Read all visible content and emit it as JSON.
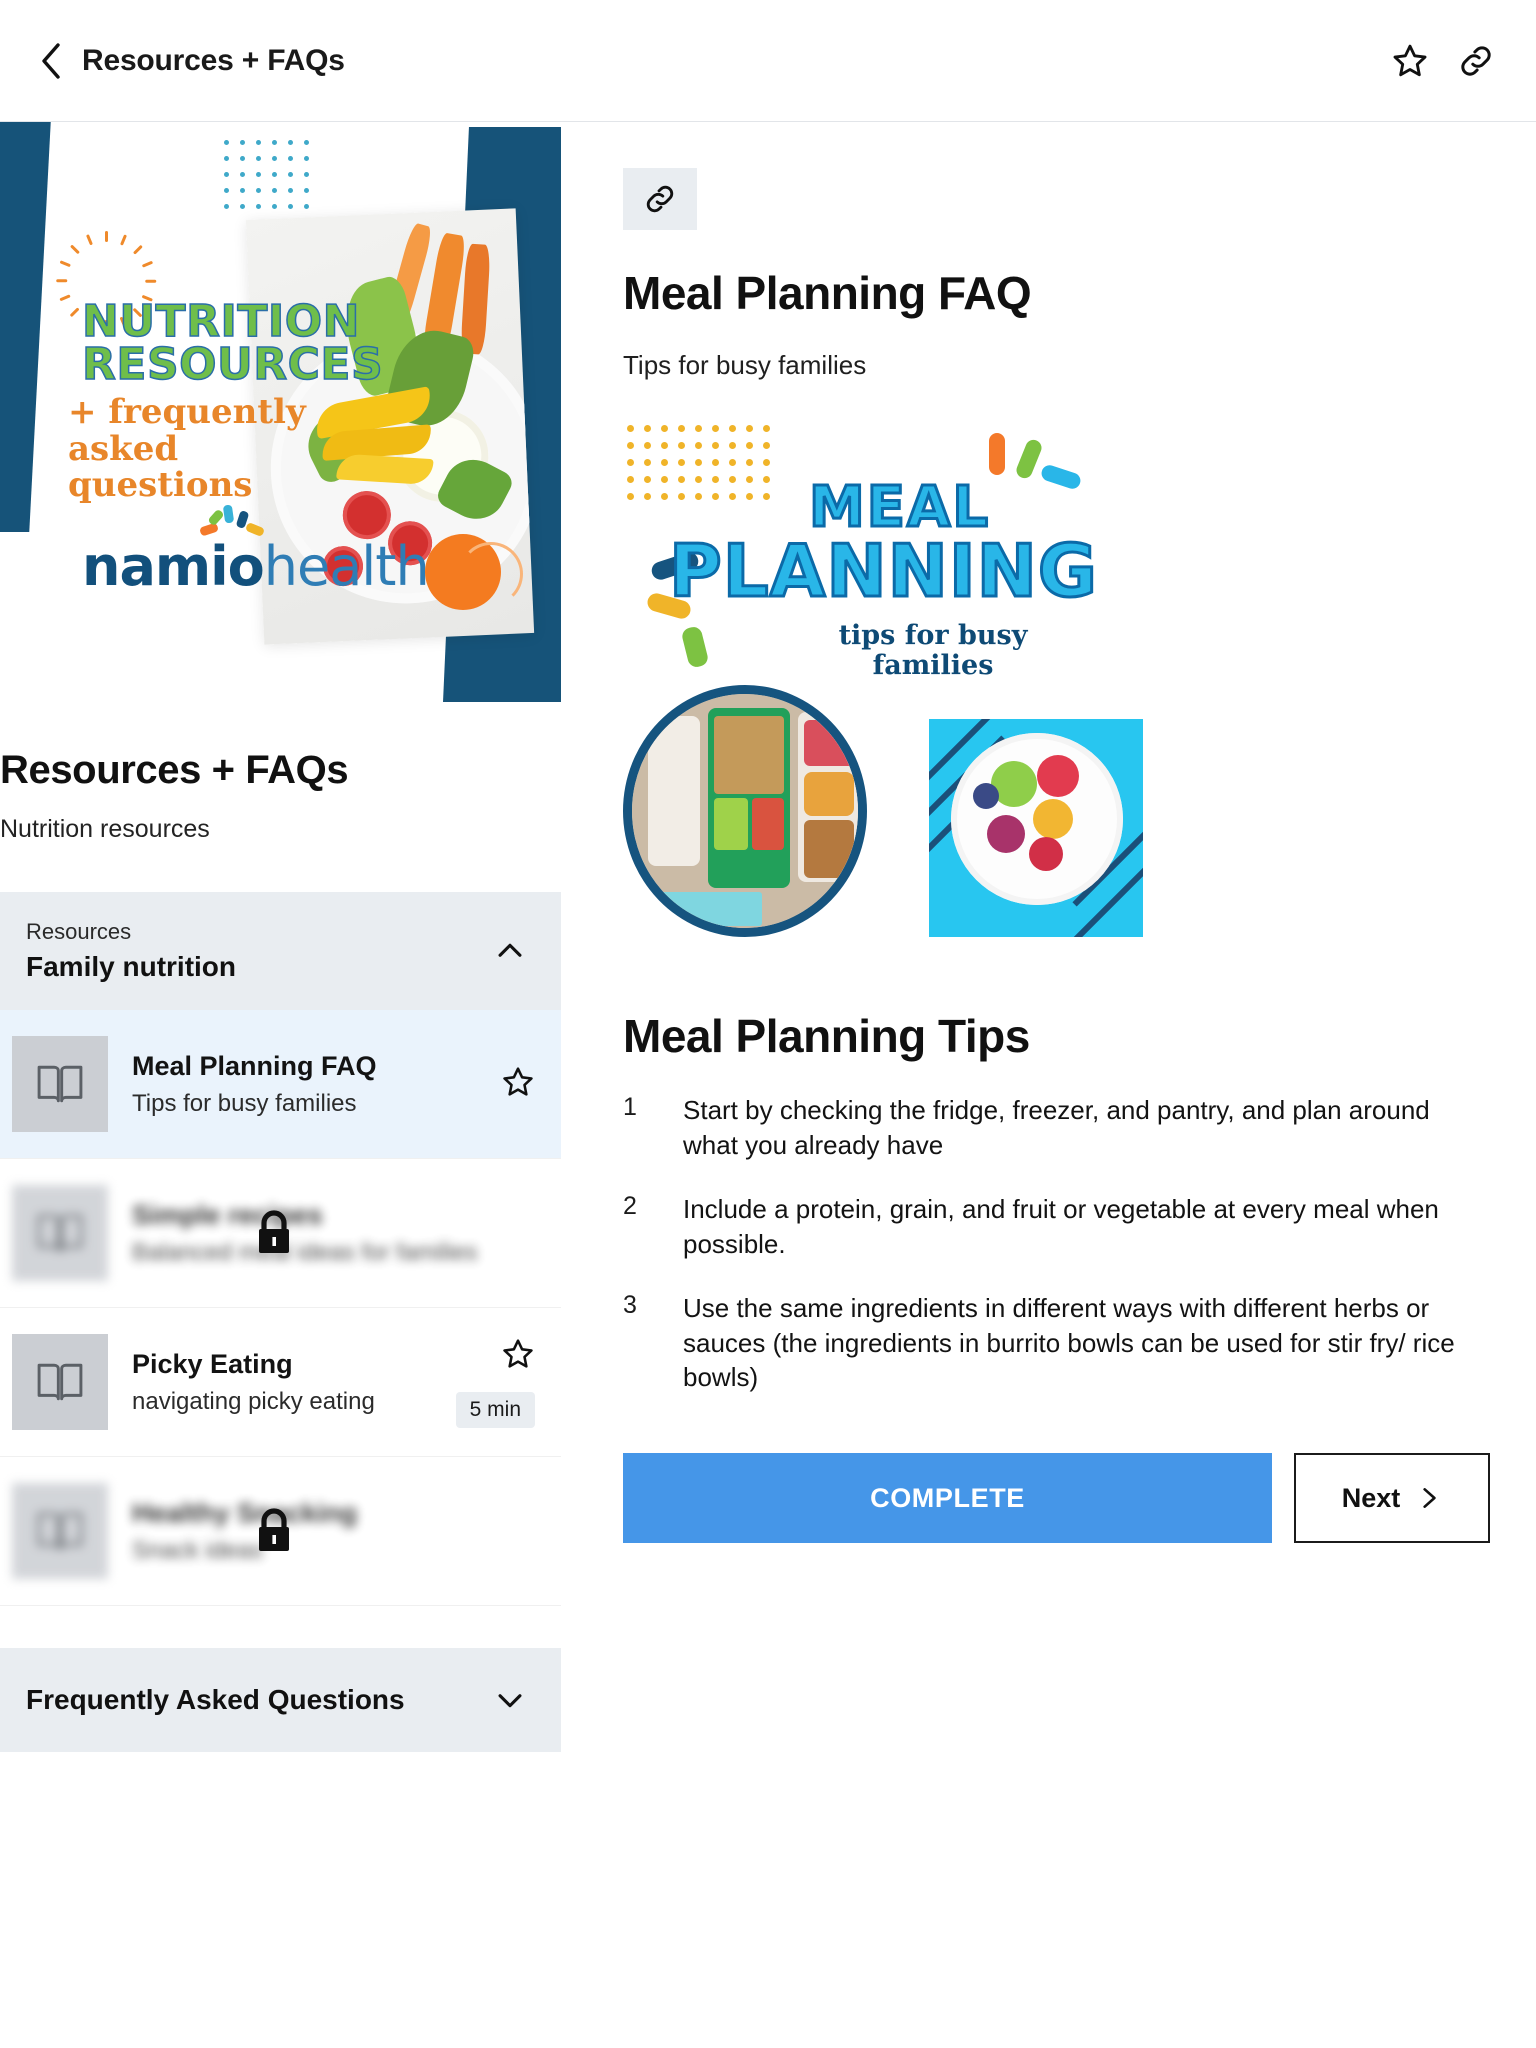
{
  "topbar": {
    "back_icon": "chevron-left-icon",
    "title": "Resources + FAQs",
    "star_icon": "star-outline-icon",
    "link_icon": "link-icon"
  },
  "hero": {
    "title_line1": "NUTRITION",
    "title_line2": "RESOURCES",
    "sub_line1": "+ frequently",
    "sub_line2": "asked",
    "sub_line3": "questions",
    "logo_primary": "namio",
    "logo_secondary": "health",
    "colors": {
      "navy": "#165379",
      "green": "#6fbe4a",
      "orange": "#e8862a",
      "dots": "#3fa9c9"
    }
  },
  "left": {
    "title": "Resources + FAQs",
    "subtitle": "Nutrition resources",
    "accordion": {
      "kicker": "Resources",
      "title": "Family nutrition",
      "expanded": true,
      "chevron_icon": "chevron-up-icon"
    },
    "items": [
      {
        "title": "Meal Planning FAQ",
        "subtitle": "Tips for busy families",
        "icon": "book-open-icon",
        "active": true,
        "locked": false,
        "star_icon": "star-outline-icon",
        "duration": ""
      },
      {
        "title": "Simple recipes",
        "subtitle": "Balanced meal ideas for families",
        "icon": "book-open-icon",
        "active": false,
        "locked": true,
        "lock_icon": "lock-icon",
        "star_icon": "",
        "duration": ""
      },
      {
        "title": "Picky Eating",
        "subtitle": "navigating picky eating",
        "icon": "book-open-icon",
        "active": false,
        "locked": false,
        "star_icon": "star-outline-icon",
        "duration": "5 min"
      },
      {
        "title": "Healthy Snacking",
        "subtitle": "Snack ideas",
        "icon": "book-open-icon",
        "active": false,
        "locked": true,
        "lock_icon": "lock-icon",
        "star_icon": "",
        "duration": ""
      }
    ],
    "faq_section": {
      "title": "Frequently Asked Questions",
      "chevron_icon": "chevron-down-icon",
      "expanded": false
    }
  },
  "right": {
    "link_icon": "link-icon",
    "title": "Meal Planning FAQ",
    "subtitle": "Tips for busy families",
    "banner": {
      "word1": "MEAL",
      "word2": "PLANNING",
      "tagline_line1": "tips for busy",
      "tagline_line2": "families",
      "colors": {
        "cyan": "#29b6e8",
        "deep_blue": "#0b6aa8",
        "gold": "#f0b429"
      }
    },
    "tips_title": "Meal Planning Tips",
    "tips": [
      {
        "num": "1",
        "text": "Start by checking the fridge, freezer, and pantry, and plan around what you already have"
      },
      {
        "num": "2",
        "text": "Include a protein, grain, and fruit or vegetable at every meal when possible."
      },
      {
        "num": "3",
        "text": "Use the same ingredients in different ways with different herbs or sauces (the ingredients in burrito bowls can be used for stir fry/ rice bowls)"
      }
    ],
    "complete_label": "COMPLETE",
    "next_label": "Next",
    "next_icon": "chevron-right-icon",
    "accent_color": "#4596e8"
  }
}
